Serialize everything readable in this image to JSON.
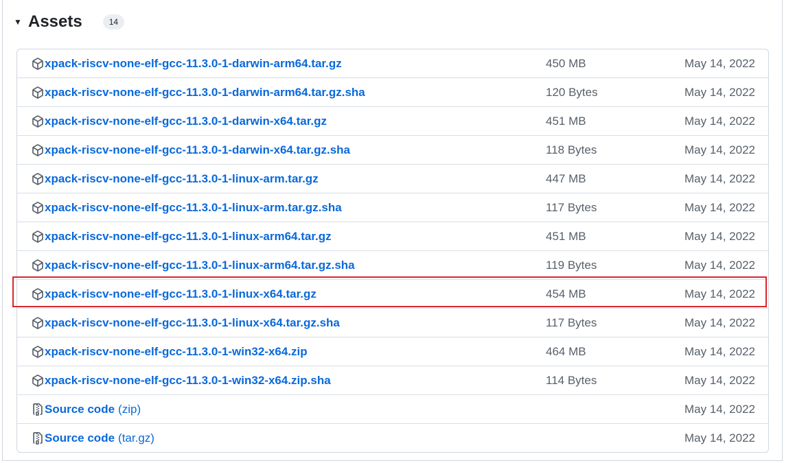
{
  "assets": {
    "title": "Assets",
    "count": "14",
    "rows": [
      {
        "name": "xpack-riscv-none-elf-gcc-11.3.0-1-darwin-arm64.tar.gz",
        "size": "450 MB",
        "date": "May 14, 2022",
        "icon": "package-icon"
      },
      {
        "name": "xpack-riscv-none-elf-gcc-11.3.0-1-darwin-arm64.tar.gz.sha",
        "size": "120 Bytes",
        "date": "May 14, 2022",
        "icon": "package-icon"
      },
      {
        "name": "xpack-riscv-none-elf-gcc-11.3.0-1-darwin-x64.tar.gz",
        "size": "451 MB",
        "date": "May 14, 2022",
        "icon": "package-icon"
      },
      {
        "name": "xpack-riscv-none-elf-gcc-11.3.0-1-darwin-x64.tar.gz.sha",
        "size": "118 Bytes",
        "date": "May 14, 2022",
        "icon": "package-icon"
      },
      {
        "name": "xpack-riscv-none-elf-gcc-11.3.0-1-linux-arm.tar.gz",
        "size": "447 MB",
        "date": "May 14, 2022",
        "icon": "package-icon"
      },
      {
        "name": "xpack-riscv-none-elf-gcc-11.3.0-1-linux-arm.tar.gz.sha",
        "size": "117 Bytes",
        "date": "May 14, 2022",
        "icon": "package-icon"
      },
      {
        "name": "xpack-riscv-none-elf-gcc-11.3.0-1-linux-arm64.tar.gz",
        "size": "451 MB",
        "date": "May 14, 2022",
        "icon": "package-icon"
      },
      {
        "name": "xpack-riscv-none-elf-gcc-11.3.0-1-linux-arm64.tar.gz.sha",
        "size": "119 Bytes",
        "date": "May 14, 2022",
        "icon": "package-icon"
      },
      {
        "name": "xpack-riscv-none-elf-gcc-11.3.0-1-linux-x64.tar.gz",
        "size": "454 MB",
        "date": "May 14, 2022",
        "icon": "package-icon"
      },
      {
        "name": "xpack-riscv-none-elf-gcc-11.3.0-1-linux-x64.tar.gz.sha",
        "size": "117 Bytes",
        "date": "May 14, 2022",
        "icon": "package-icon"
      },
      {
        "name": "xpack-riscv-none-elf-gcc-11.3.0-1-win32-x64.zip",
        "size": "464 MB",
        "date": "May 14, 2022",
        "icon": "package-icon"
      },
      {
        "name": "xpack-riscv-none-elf-gcc-11.3.0-1-win32-x64.zip.sha",
        "size": "114 Bytes",
        "date": "May 14, 2022",
        "icon": "package-icon"
      },
      {
        "name": "Source code",
        "suffix": "(zip)",
        "size": "",
        "date": "May 14, 2022",
        "icon": "file-zip-icon"
      },
      {
        "name": "Source code",
        "suffix": "(tar.gz)",
        "size": "",
        "date": "May 14, 2022",
        "icon": "file-zip-icon"
      }
    ]
  },
  "colors": {
    "link": "#0969da",
    "muted": "#57606a",
    "highlight": "#d9262c"
  }
}
